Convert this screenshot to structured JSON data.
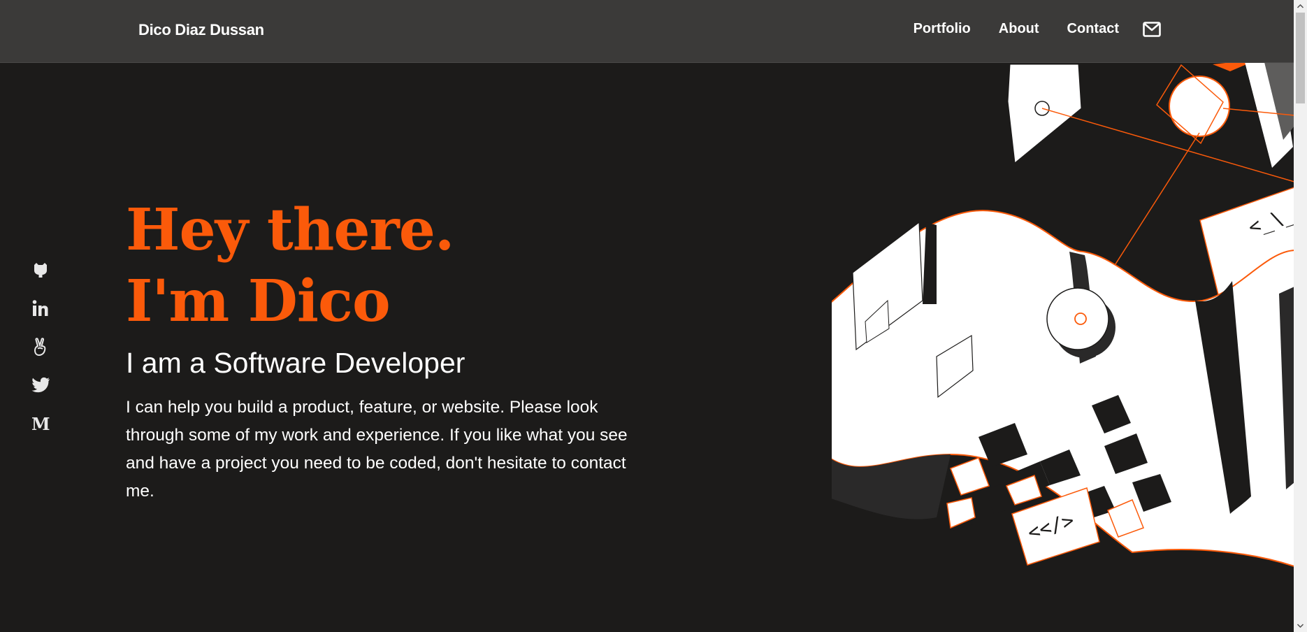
{
  "brand": "Dico Diaz Dussan",
  "nav": {
    "items": [
      "Portfolio",
      "About",
      "Contact"
    ],
    "mail_icon": "envelope-icon"
  },
  "socials": [
    "github-icon",
    "linkedin-icon",
    "angellist-icon",
    "twitter-icon",
    "medium-icon"
  ],
  "hero": {
    "line1": "Hey there.",
    "line2": "I'm Dico",
    "role": "I am a Software Developer",
    "description": "I can help you build a product, feature, or website. Please look through some of my work and experience. If you like what you see and have a project you need to be coded, don't hesitate to contact me."
  },
  "art": {
    "tag1": "<_\\_",
    "tag2": "<</>"
  },
  "colors": {
    "accent": "#fb5a0a",
    "background": "#1c1b1a",
    "header": "#3b3a39"
  }
}
